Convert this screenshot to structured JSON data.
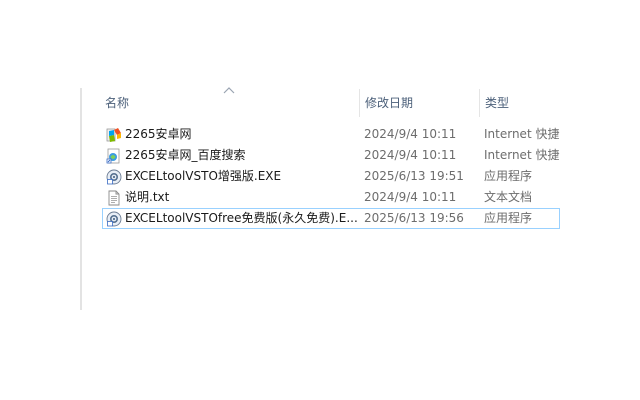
{
  "columns": {
    "name": "名称",
    "date": "修改日期",
    "type": "类型"
  },
  "files": [
    {
      "name": "2265安卓网",
      "date": "2024/9/4 10:11",
      "type": "Internet 快捷方式",
      "icon": "internet-shortcut-icon"
    },
    {
      "name": "2265安卓网_百度搜索",
      "date": "2024/9/4 10:11",
      "type": "Internet 快捷方式",
      "icon": "internet-shortcut-icon"
    },
    {
      "name": "EXCELtoolVSTO增强版.EXE",
      "date": "2025/6/13 19:51",
      "type": "应用程序",
      "icon": "application-icon"
    },
    {
      "name": "说明.txt",
      "date": "2024/9/4 10:11",
      "type": "文本文档",
      "icon": "text-document-icon"
    },
    {
      "name": "EXCELtoolVSTOfree免费版(永久免费).E...",
      "date": "2025/6/13 19:56",
      "type": "应用程序",
      "icon": "application-icon"
    }
  ],
  "selected_index": 4,
  "colors": {
    "header_text": "#4c607a",
    "secondary_text": "#6d6d6d",
    "selection_border": "#99d1ff"
  }
}
